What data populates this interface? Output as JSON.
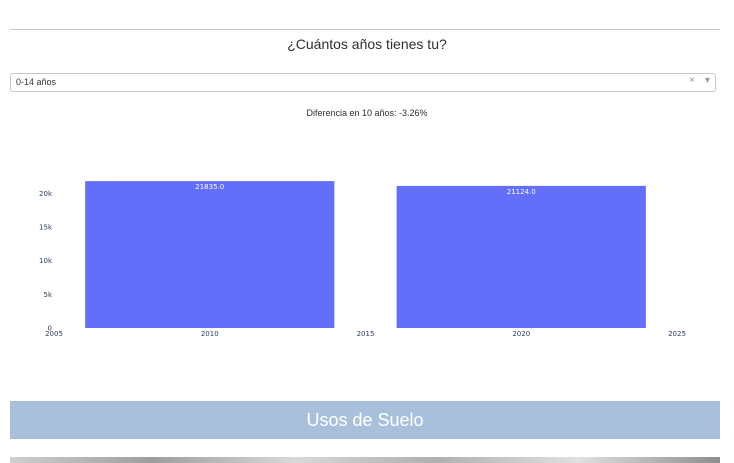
{
  "question": "¿Cuántos años tienes tu?",
  "age_select": {
    "value": "0-14 años",
    "clear_symbol": "×",
    "arrow_symbol": "▾"
  },
  "difference_text": "Diferencia en 10 años: -3.26%",
  "chart_data": {
    "type": "bar",
    "x": [
      2010,
      2020
    ],
    "values": [
      21835.0,
      21124.0
    ],
    "value_labels": [
      "21835.0",
      "21124.0"
    ],
    "bar_width": 8,
    "xlim": [
      2005,
      2025
    ],
    "ylim": [
      0,
      22000
    ],
    "x_ticks": [
      2005,
      2010,
      2015,
      2020,
      2025
    ],
    "y_ticks": [
      0,
      5000,
      10000,
      15000,
      20000
    ],
    "y_tick_labels": [
      "0",
      "5k",
      "10k",
      "15k",
      "20k"
    ],
    "bar_color": "#636efa",
    "grid": false
  },
  "section_banner": {
    "label": "Usos de Suelo",
    "color": "#a9c0dc"
  }
}
